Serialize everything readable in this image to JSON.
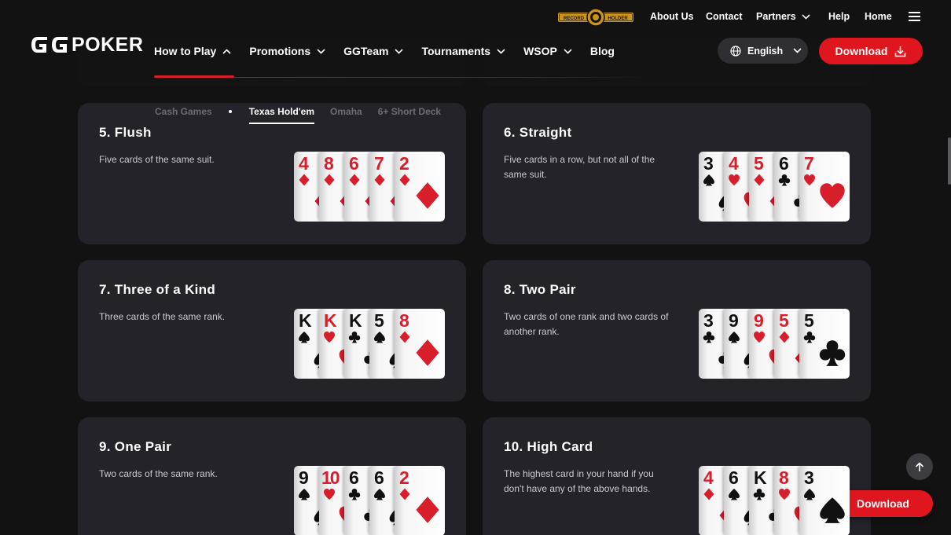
{
  "header": {
    "logo_text": "POKER",
    "logo_mark": "GG",
    "record_badge": {
      "left": "RECORD",
      "right": "HOLDER"
    },
    "top_links": [
      "About Us",
      "Contact",
      "Partners",
      "Help",
      "Home"
    ],
    "nav": [
      {
        "label": "How to Play",
        "chevron": "up"
      },
      {
        "label": "Promotions",
        "chevron": "down"
      },
      {
        "label": "GGTeam",
        "chevron": "down"
      },
      {
        "label": "Tournaments",
        "chevron": "down"
      },
      {
        "label": "WSOP",
        "chevron": "down"
      },
      {
        "label": "Blog",
        "chevron": "none"
      }
    ],
    "language": "English",
    "download_label": "Download"
  },
  "subnav": {
    "items": [
      "Cash Games",
      "Texas Hold'em",
      "Omaha",
      "6+ Short Deck"
    ],
    "active": "Texas Hold'em"
  },
  "hands": [
    {
      "title": "5. Flush",
      "desc": "Five cards of the same suit.",
      "cards": [
        [
          "4",
          "diamond"
        ],
        [
          "8",
          "diamond"
        ],
        [
          "6",
          "diamond"
        ],
        [
          "7",
          "diamond"
        ],
        [
          "2",
          "diamond"
        ]
      ]
    },
    {
      "title": "6. Straight",
      "desc": "Five cards in a row, but not all of the same suit.",
      "cards": [
        [
          "3",
          "spade"
        ],
        [
          "4",
          "heart"
        ],
        [
          "5",
          "diamond"
        ],
        [
          "6",
          "club"
        ],
        [
          "7",
          "heart"
        ]
      ]
    },
    {
      "title": "7. Three of a Kind",
      "desc": "Three cards of the same rank.",
      "cards": [
        [
          "K",
          "spade"
        ],
        [
          "K",
          "heart"
        ],
        [
          "K",
          "club"
        ],
        [
          "5",
          "spade"
        ],
        [
          "8",
          "diamond"
        ]
      ]
    },
    {
      "title": "8. Two Pair",
      "desc": "Two cards of one rank and two cards of another rank.",
      "cards": [
        [
          "3",
          "club"
        ],
        [
          "9",
          "spade"
        ],
        [
          "9",
          "heart"
        ],
        [
          "5",
          "diamond"
        ],
        [
          "5",
          "club"
        ]
      ]
    },
    {
      "title": "9. One Pair",
      "desc": "Two cards of the same rank.",
      "cards": [
        [
          "9",
          "spade"
        ],
        [
          "10",
          "heart"
        ],
        [
          "6",
          "club"
        ],
        [
          "6",
          "spade"
        ],
        [
          "2",
          "diamond"
        ]
      ]
    },
    {
      "title": "10. High Card",
      "desc": "The highest card in your hand if you don't have any of the above hands.",
      "cards": [
        [
          "4",
          "diamond"
        ],
        [
          "6",
          "spade"
        ],
        [
          "K",
          "club"
        ],
        [
          "8",
          "heart"
        ],
        [
          "3",
          "spade"
        ]
      ]
    }
  ],
  "floating": {
    "download_label": "Download",
    "scroll_top_icon": "arrow-up-icon"
  },
  "colors": {
    "accent": "#e0161f",
    "panel": "#232329",
    "background": "#121212"
  }
}
